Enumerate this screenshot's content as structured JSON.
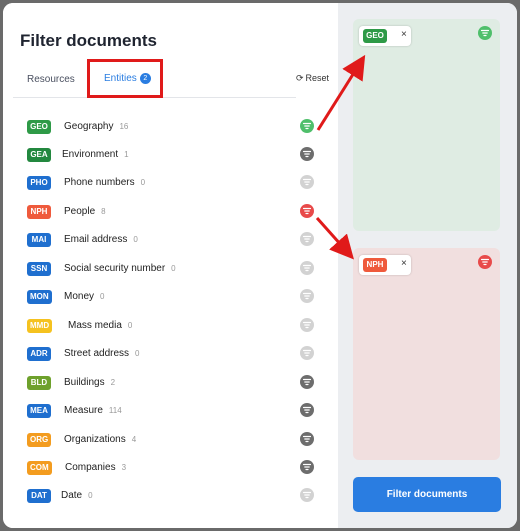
{
  "title": "Filter documents",
  "tabs": [
    {
      "label": "Resources"
    },
    {
      "label": "Entities",
      "count": "2"
    }
  ],
  "reset_label": "Reset",
  "colors": {
    "green": "#2e9a47",
    "darkgreen": "#23883f",
    "blue": "#1f6fcf",
    "red": "#ef5a3c",
    "yellow": "#f5c21f",
    "olive": "#6ea12c",
    "orange": "#f39c1f",
    "gray_icon": "#6d6d6d",
    "light_icon": "#d2d2d2",
    "active_green": "#4fbf6b",
    "active_red": "#e84a4a"
  },
  "entities": [
    {
      "tag": "GEO",
      "label": "Geography",
      "count": "16",
      "tag_color": "#2e9a47",
      "filter_state": "active-green"
    },
    {
      "tag": "GEA",
      "label": "Environment",
      "count": "1",
      "tag_color": "#23883f",
      "filter_state": "available"
    },
    {
      "tag": "PHO",
      "label": "Phone numbers",
      "count": "0",
      "tag_color": "#1f6fcf",
      "filter_state": "disabled"
    },
    {
      "tag": "NPH",
      "label": "People",
      "count": "8",
      "tag_color": "#ef5a3c",
      "filter_state": "active-red"
    },
    {
      "tag": "MAI",
      "label": "Email address",
      "count": "0",
      "tag_color": "#1f6fcf",
      "filter_state": "disabled"
    },
    {
      "tag": "SSN",
      "label": "Social security number",
      "count": "0",
      "tag_color": "#1f6fcf",
      "filter_state": "disabled"
    },
    {
      "tag": "MON",
      "label": "Money",
      "count": "0",
      "tag_color": "#1f6fcf",
      "filter_state": "disabled"
    },
    {
      "tag": "MMD",
      "label": "Mass media",
      "count": "0",
      "tag_color": "#f5c21f",
      "filter_state": "disabled"
    },
    {
      "tag": "ADR",
      "label": "Street address",
      "count": "0",
      "tag_color": "#1f6fcf",
      "filter_state": "disabled"
    },
    {
      "tag": "BLD",
      "label": "Buildings",
      "count": "2",
      "tag_color": "#6ea12c",
      "filter_state": "available"
    },
    {
      "tag": "MEA",
      "label": "Measure",
      "count": "114",
      "tag_color": "#1f6fcf",
      "filter_state": "available"
    },
    {
      "tag": "ORG",
      "label": "Organizations",
      "count": "4",
      "tag_color": "#f39c1f",
      "filter_state": "available"
    },
    {
      "tag": "COM",
      "label": "Companies",
      "count": "3",
      "tag_color": "#f39c1f",
      "filter_state": "available"
    },
    {
      "tag": "DAT",
      "label": "Date",
      "count": "0",
      "tag_color": "#1f6fcf",
      "filter_state": "disabled"
    }
  ],
  "panels": [
    {
      "chip_tag": "GEO",
      "chip_color": "#2e9a47",
      "close": "×",
      "icon_color": "#4fbf6b"
    },
    {
      "chip_tag": "NPH",
      "chip_color": "#ef5a3c",
      "close": "×",
      "icon_color": "#e84a4a"
    }
  ],
  "submit_label": "Filter documents"
}
